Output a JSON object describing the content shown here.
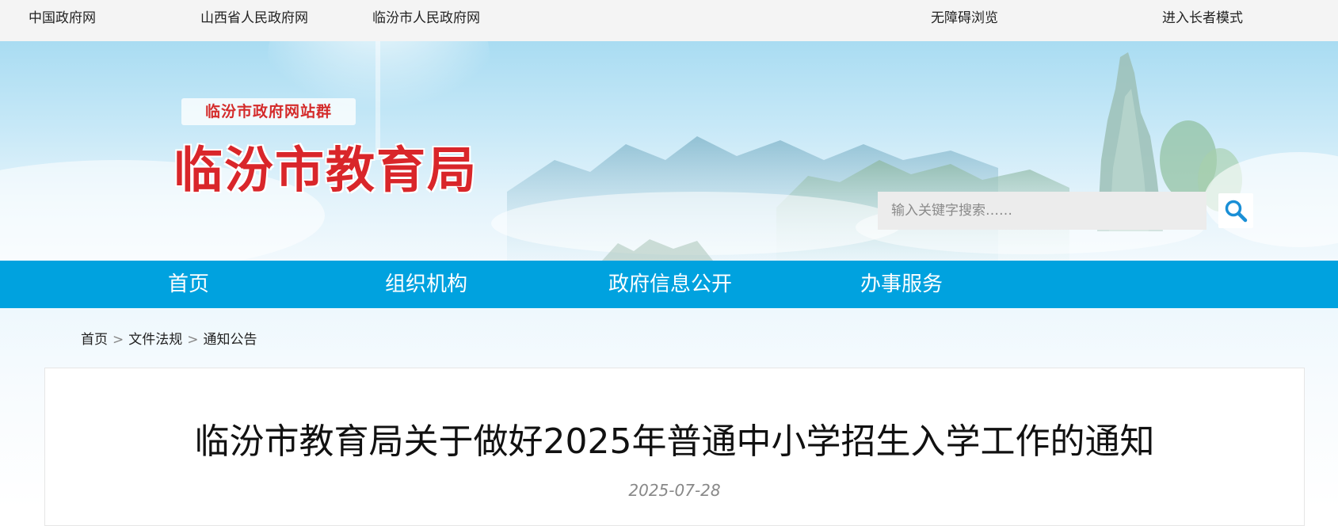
{
  "topbar": {
    "links": [
      "中国政府网",
      "山西省人民政府网",
      "临汾市人民政府网"
    ],
    "accessibility": "无障碍浏览",
    "elder_mode": "进入长者模式"
  },
  "header": {
    "site_group": "临汾市政府网站群",
    "site_title": "临汾市教育局",
    "search_placeholder": "输入关键字搜索……"
  },
  "nav": {
    "items": [
      "首页",
      "组织机构",
      "政府信息公开",
      "办事服务"
    ]
  },
  "breadcrumb": {
    "items": [
      "首页",
      "文件法规",
      "通知公告"
    ],
    "separator": ">"
  },
  "article": {
    "title": "临汾市教育局关于做好2025年普通中小学招生入学工作的通知",
    "date": "2025-07-28"
  },
  "colors": {
    "nav_bg": "#00a2df",
    "title_red": "#d9262a",
    "search_icon": "#1a8fd6"
  },
  "icons": {
    "search": "magnifier-icon"
  }
}
